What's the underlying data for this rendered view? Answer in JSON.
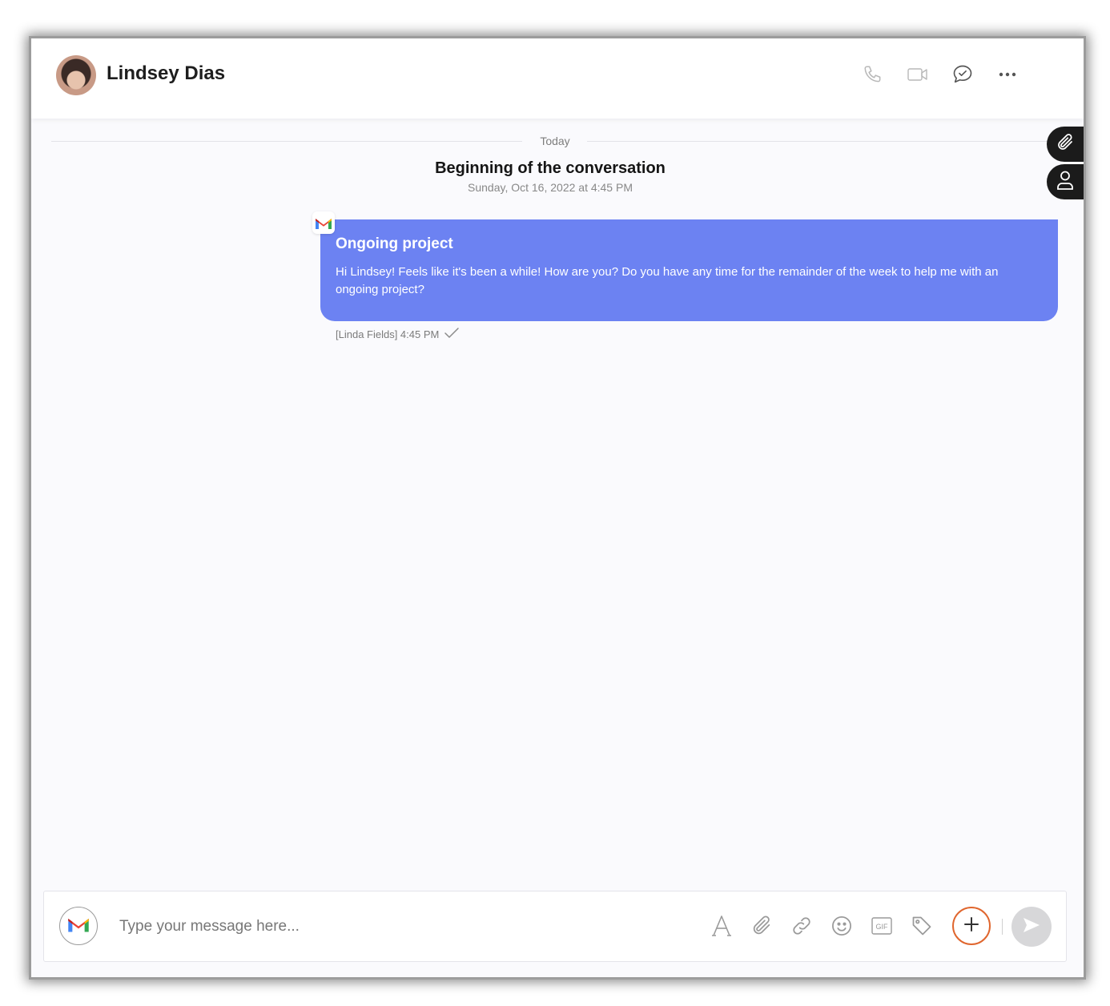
{
  "header": {
    "contact_name": "Lindsey Dias",
    "actions": [
      "phone-icon",
      "video-icon",
      "chat-check-icon",
      "more-icon"
    ]
  },
  "conversation": {
    "day_label": "Today",
    "title": "Beginning of the conversation",
    "started": "Sunday, Oct 16, 2022 at 4:45 PM"
  },
  "side_tabs": [
    "paperclip-icon",
    "user-icon"
  ],
  "message": {
    "channel_icon": "gmail-icon",
    "subject": "Ongoing project",
    "body": "Hi Lindsey! Feels like it's been a while! How are you? Do you have any time for the remainder of the week to help me with an ongoing project?",
    "meta": "[Linda Fields] 4:45 PM",
    "status_icon": "check-icon"
  },
  "composer": {
    "channel_icon": "gmail-icon",
    "placeholder": "Type your message here...",
    "tools": [
      "text-format-icon",
      "attach-icon",
      "link-icon",
      "emoji-icon",
      "gif-icon",
      "tag-icon"
    ],
    "gif_label": "GIF"
  },
  "colors": {
    "bubble": "#6c82f2",
    "add_ring": "#e0662e",
    "send_bg": "#d7d7d9"
  }
}
